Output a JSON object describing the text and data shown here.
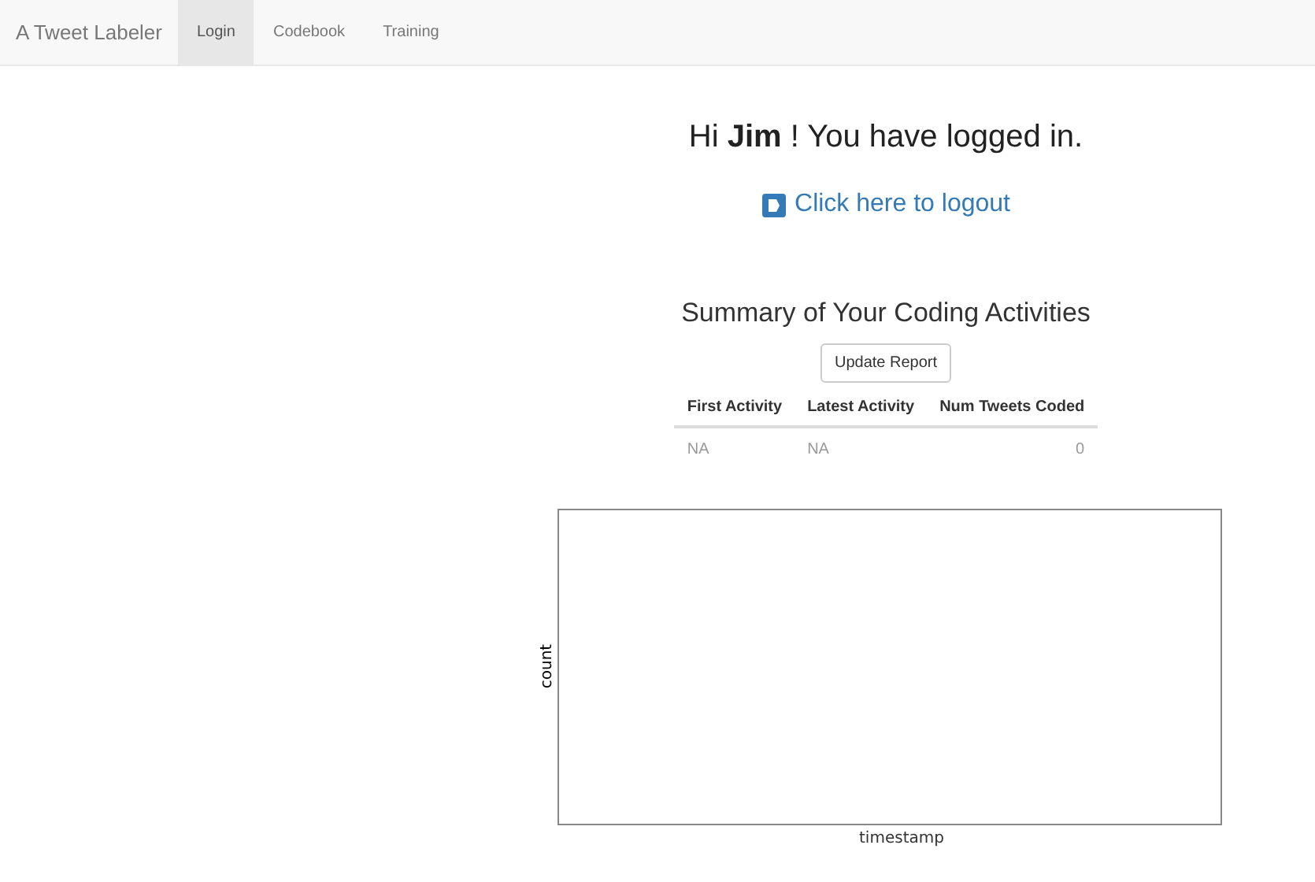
{
  "navbar": {
    "brand": "A Tweet Labeler",
    "tabs": [
      {
        "label": "Login",
        "selected": true
      },
      {
        "label": "Codebook",
        "selected": false
      },
      {
        "label": "Training",
        "selected": false
      }
    ]
  },
  "greeting": "Hi **Jim** ! You have logged in.",
  "logout_link": "Click here to logout",
  "summary": {
    "title": "Summary of Your Coding Activities",
    "button": "Update Report",
    "columns": [
      "First Activity",
      "Latest Activity",
      "Num Tweets Coded"
    ],
    "rows": [
      [
        "NA",
        "NA",
        "0"
      ]
    ]
  },
  "plot": {
    "xlabel": "timestamp",
    "ylabel": "count"
  }
}
